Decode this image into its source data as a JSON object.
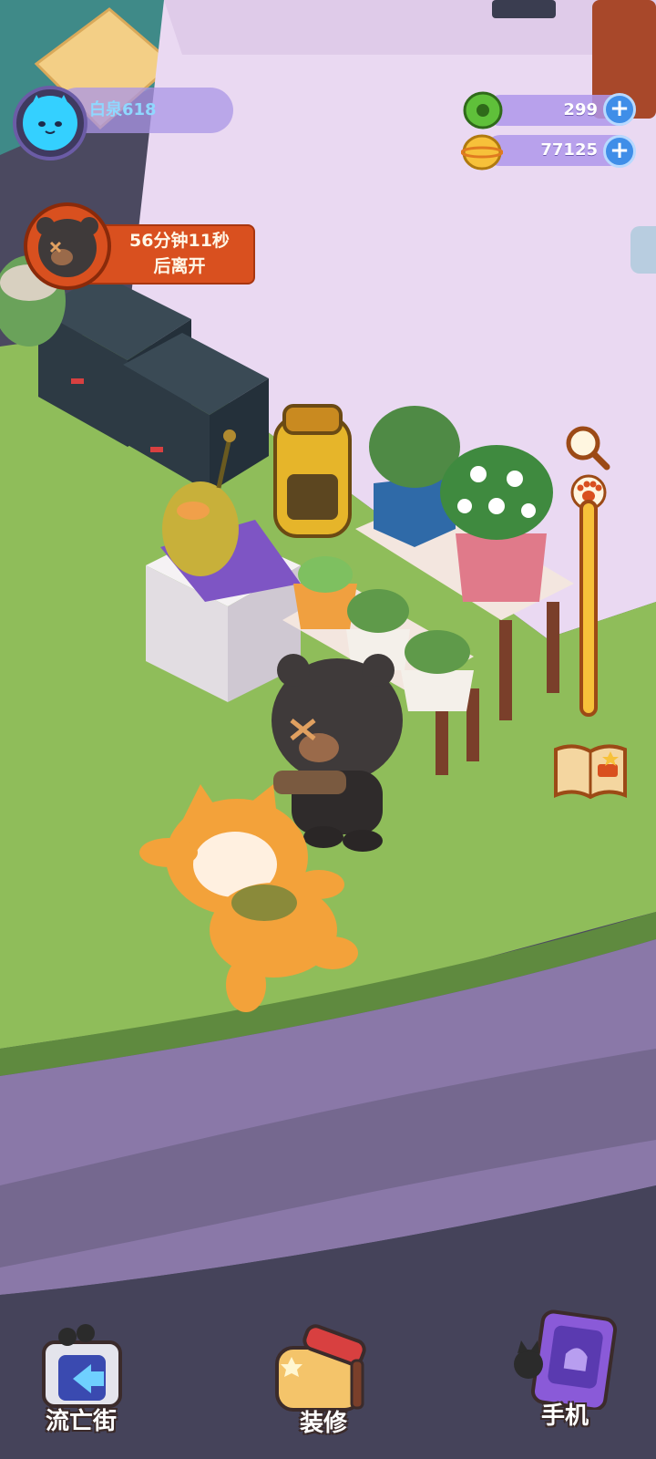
{
  "player": {
    "name": "白泉618"
  },
  "currencies": [
    {
      "icon": "green-donut-icon",
      "value": "299"
    },
    {
      "icon": "gold-coin-icon",
      "value": "77125"
    }
  ],
  "visitor": {
    "timer_line1": "56分钟11秒",
    "timer_line2": "后离开"
  },
  "nav": {
    "street_label": "流亡街",
    "decorate_label": "装修",
    "phone_label": "手机"
  },
  "colors": {
    "accent": "#d9501f",
    "currency_bar": "#af96eb",
    "plus_button": "#3f8ee8"
  }
}
